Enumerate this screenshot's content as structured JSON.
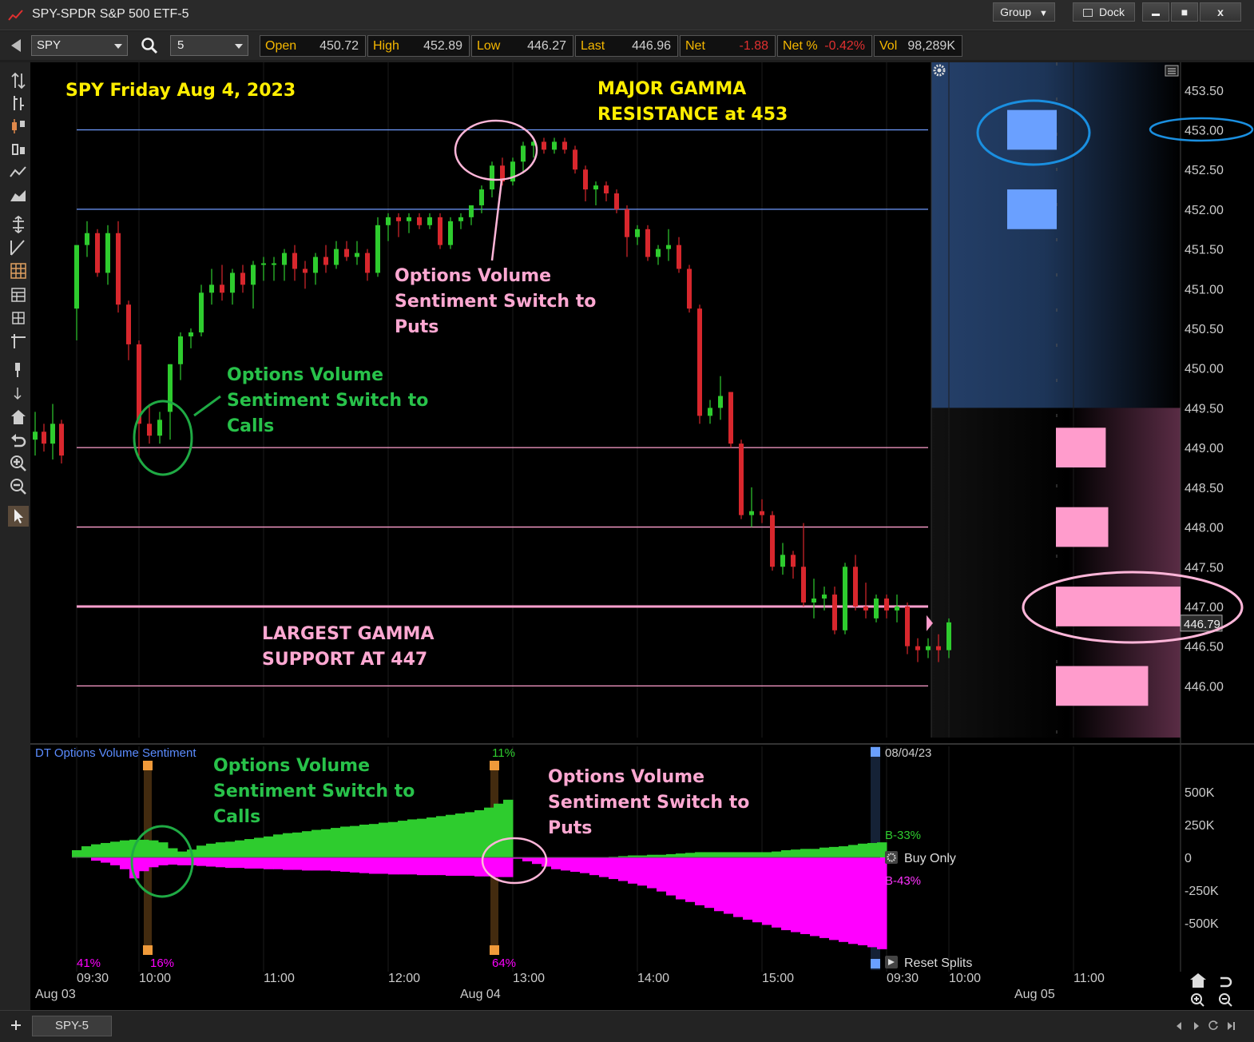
{
  "window": {
    "title": "SPY-SPDR S&P 500 ETF-5",
    "group_label": "Group",
    "dock_label": "Dock",
    "min_label": "▬",
    "max_label": "■",
    "close_label": "x"
  },
  "toolbar": {
    "symbol": "SPY",
    "interval": "5",
    "quotes": [
      {
        "label": "Open",
        "value": "450.72",
        "neg": false
      },
      {
        "label": "High",
        "value": "452.89",
        "neg": false
      },
      {
        "label": "Low",
        "value": "446.27",
        "neg": false
      },
      {
        "label": "Last",
        "value": "446.96",
        "neg": false
      },
      {
        "label": "Net",
        "value": "-1.88",
        "neg": true
      },
      {
        "label": "Net %",
        "value": "-0.42%",
        "neg": true
      },
      {
        "label": "Vol",
        "value": "98,289K",
        "neg": false
      }
    ]
  },
  "tab_label": "SPY-5",
  "colors": {
    "up": "#2ecc2e",
    "down": "#d8272d",
    "resistance_line": "#6f9bff",
    "support_line": "#ff9fce",
    "call_fill": "#2ecc2e",
    "put_fill": "#ff00ff",
    "annot_yellow": "#ffee00",
    "annot_green": "#28c24a",
    "annot_pink": "#ffa8d2"
  },
  "annotations": {
    "chart_title": "SPY Friday Aug 4, 2023",
    "major_gamma_line1": "MAJOR GAMMA",
    "major_gamma_line2": "RESISTANCE at 453",
    "largest_gamma_line1": "LARGEST GAMMA",
    "largest_gamma_line2": "SUPPORT AT 447",
    "calls_switch": [
      "Options Volume",
      "Sentiment Switch to",
      "Calls"
    ],
    "puts_switch": [
      "Options Volume",
      "Sentiment Switch to",
      "Puts"
    ],
    "calls_switch_lower": [
      "Options Volume",
      "Sentiment Switch to",
      "Calls"
    ],
    "puts_switch_lower": [
      "Options Volume",
      "Sentiment Switch to",
      "Puts"
    ]
  },
  "chart_data": [
    {
      "type": "candlestick",
      "title": "SPY Friday Aug 4, 2023",
      "ylim": [
        445.35,
        453.85
      ],
      "y_ticks": [
        "453.50",
        "453.00",
        "452.50",
        "452.00",
        "451.50",
        "451.00",
        "450.50",
        "450.00",
        "449.50",
        "449.00",
        "448.50",
        "448.00",
        "447.50",
        "447.00",
        "446.50",
        "446.00"
      ],
      "last_price_label": "446.79",
      "x_tick_labels": [
        "09:30",
        "10:00",
        "11:00",
        "12:00",
        "13:00",
        "14:00",
        "15:00",
        "09:30",
        "10:00",
        "11:00"
      ],
      "date_labels": [
        "Aug 03",
        "Aug 04",
        "Aug 05"
      ],
      "gamma_levels": [
        {
          "price": 453.0,
          "kind": "resistance",
          "size": 0.2
        },
        {
          "price": 452.0,
          "kind": "resistance",
          "size": 0.2
        },
        {
          "price": 449.0,
          "kind": "support",
          "size": 0.2
        },
        {
          "price": 448.0,
          "kind": "support",
          "size": 0.21
        },
        {
          "price": 447.0,
          "kind": "support",
          "size": 0.5
        },
        {
          "price": 446.0,
          "kind": "support",
          "size": 0.37
        }
      ],
      "candles_prev_day": [
        {
          "o": 449.1,
          "h": 449.45,
          "l": 448.9,
          "c": 449.2
        },
        {
          "o": 449.2,
          "h": 449.3,
          "l": 448.95,
          "c": 449.05
        },
        {
          "o": 449.05,
          "h": 449.55,
          "l": 448.85,
          "c": 449.3
        },
        {
          "o": 449.3,
          "h": 449.35,
          "l": 448.8,
          "c": 448.9
        }
      ],
      "candles": [
        {
          "o": 450.75,
          "h": 451.5,
          "l": 450.35,
          "c": 451.55
        },
        {
          "o": 451.55,
          "h": 451.85,
          "l": 451.4,
          "c": 451.7
        },
        {
          "o": 451.7,
          "h": 451.75,
          "l": 451.15,
          "c": 451.2
        },
        {
          "o": 451.2,
          "h": 451.8,
          "l": 451.05,
          "c": 451.7
        },
        {
          "o": 451.7,
          "h": 451.85,
          "l": 450.7,
          "c": 450.8
        },
        {
          "o": 450.8,
          "h": 450.85,
          "l": 450.1,
          "c": 450.3
        },
        {
          "o": 450.3,
          "h": 450.35,
          "l": 448.85,
          "c": 449.3
        },
        {
          "o": 449.3,
          "h": 449.55,
          "l": 449.05,
          "c": 449.15
        },
        {
          "o": 449.15,
          "h": 449.45,
          "l": 449.05,
          "c": 449.35
        },
        {
          "o": 449.45,
          "h": 450.05,
          "l": 449.1,
          "c": 450.05
        },
        {
          "o": 450.05,
          "h": 450.45,
          "l": 449.85,
          "c": 450.4
        },
        {
          "o": 450.4,
          "h": 450.5,
          "l": 450.25,
          "c": 450.45
        },
        {
          "o": 450.45,
          "h": 451.05,
          "l": 450.4,
          "c": 450.95
        },
        {
          "o": 450.95,
          "h": 451.25,
          "l": 450.8,
          "c": 451.05
        },
        {
          "o": 451.05,
          "h": 451.3,
          "l": 450.85,
          "c": 450.95
        },
        {
          "o": 450.95,
          "h": 451.25,
          "l": 450.8,
          "c": 451.2
        },
        {
          "o": 451.2,
          "h": 451.3,
          "l": 450.95,
          "c": 451.05
        },
        {
          "o": 451.05,
          "h": 451.35,
          "l": 450.75,
          "c": 451.3
        },
        {
          "o": 451.3,
          "h": 451.4,
          "l": 451.1,
          "c": 451.32
        },
        {
          "o": 451.3,
          "h": 451.4,
          "l": 451.1,
          "c": 451.32
        },
        {
          "o": 451.3,
          "h": 451.5,
          "l": 451.1,
          "c": 451.45
        },
        {
          "o": 451.45,
          "h": 451.55,
          "l": 451.1,
          "c": 451.25
        },
        {
          "o": 451.25,
          "h": 451.35,
          "l": 451.0,
          "c": 451.2
        },
        {
          "o": 451.2,
          "h": 451.45,
          "l": 451.05,
          "c": 451.4
        },
        {
          "o": 451.4,
          "h": 451.55,
          "l": 451.2,
          "c": 451.3
        },
        {
          "o": 451.3,
          "h": 451.6,
          "l": 451.25,
          "c": 451.5
        },
        {
          "o": 451.5,
          "h": 451.6,
          "l": 451.35,
          "c": 451.4
        },
        {
          "o": 451.4,
          "h": 451.6,
          "l": 451.3,
          "c": 451.45
        },
        {
          "o": 451.45,
          "h": 451.5,
          "l": 451.1,
          "c": 451.2
        },
        {
          "o": 451.2,
          "h": 451.9,
          "l": 451.15,
          "c": 451.8
        },
        {
          "o": 451.8,
          "h": 451.95,
          "l": 451.6,
          "c": 451.9
        },
        {
          "o": 451.9,
          "h": 451.95,
          "l": 451.65,
          "c": 451.85
        },
        {
          "o": 451.85,
          "h": 451.95,
          "l": 451.7,
          "c": 451.9
        },
        {
          "o": 451.9,
          "h": 451.95,
          "l": 451.75,
          "c": 451.8
        },
        {
          "o": 451.8,
          "h": 451.95,
          "l": 451.75,
          "c": 451.9
        },
        {
          "o": 451.9,
          "h": 451.95,
          "l": 451.5,
          "c": 451.55
        },
        {
          "o": 451.55,
          "h": 451.9,
          "l": 451.5,
          "c": 451.85
        },
        {
          "o": 451.85,
          "h": 451.95,
          "l": 451.75,
          "c": 451.9
        },
        {
          "o": 451.9,
          "h": 452.05,
          "l": 451.8,
          "c": 452.05
        },
        {
          "o": 452.05,
          "h": 452.3,
          "l": 451.95,
          "c": 452.25
        },
        {
          "o": 452.25,
          "h": 452.6,
          "l": 452.15,
          "c": 452.55
        },
        {
          "o": 452.55,
          "h": 452.65,
          "l": 452.3,
          "c": 452.35
        },
        {
          "o": 452.35,
          "h": 452.65,
          "l": 452.3,
          "c": 452.6
        },
        {
          "o": 452.6,
          "h": 452.85,
          "l": 452.45,
          "c": 452.8
        },
        {
          "o": 452.8,
          "h": 452.9,
          "l": 452.65,
          "c": 452.85
        },
        {
          "o": 452.85,
          "h": 452.9,
          "l": 452.7,
          "c": 452.75
        },
        {
          "o": 452.75,
          "h": 452.9,
          "l": 452.7,
          "c": 452.85
        },
        {
          "o": 452.85,
          "h": 452.9,
          "l": 452.7,
          "c": 452.75
        },
        {
          "o": 452.75,
          "h": 452.8,
          "l": 452.45,
          "c": 452.5
        },
        {
          "o": 452.5,
          "h": 452.55,
          "l": 452.1,
          "c": 452.25
        },
        {
          "o": 452.25,
          "h": 452.35,
          "l": 452.05,
          "c": 452.3
        },
        {
          "o": 452.3,
          "h": 452.35,
          "l": 452.1,
          "c": 452.2
        },
        {
          "o": 452.2,
          "h": 452.25,
          "l": 451.95,
          "c": 452.0
        },
        {
          "o": 452.0,
          "h": 452.05,
          "l": 451.4,
          "c": 451.65
        },
        {
          "o": 451.65,
          "h": 451.8,
          "l": 451.55,
          "c": 451.75
        },
        {
          "o": 451.75,
          "h": 451.8,
          "l": 451.35,
          "c": 451.4
        },
        {
          "o": 451.4,
          "h": 451.55,
          "l": 451.3,
          "c": 451.5
        },
        {
          "o": 451.5,
          "h": 451.75,
          "l": 451.35,
          "c": 451.55
        },
        {
          "o": 451.55,
          "h": 451.65,
          "l": 451.2,
          "c": 451.25
        },
        {
          "o": 451.25,
          "h": 451.3,
          "l": 450.7,
          "c": 450.75
        },
        {
          "o": 450.75,
          "h": 450.8,
          "l": 449.3,
          "c": 449.4
        },
        {
          "o": 449.4,
          "h": 449.6,
          "l": 449.3,
          "c": 449.5
        },
        {
          "o": 449.5,
          "h": 449.9,
          "l": 449.35,
          "c": 449.65
        },
        {
          "o": 449.7,
          "h": 449.7,
          "l": 449.0,
          "c": 449.05
        },
        {
          "o": 449.05,
          "h": 449.1,
          "l": 448.1,
          "c": 448.15
        },
        {
          "o": 448.15,
          "h": 448.5,
          "l": 448.0,
          "c": 448.2
        },
        {
          "o": 448.2,
          "h": 448.35,
          "l": 448.05,
          "c": 448.15
        },
        {
          "o": 448.15,
          "h": 448.2,
          "l": 447.45,
          "c": 447.5
        },
        {
          "o": 447.5,
          "h": 447.8,
          "l": 447.4,
          "c": 447.65
        },
        {
          "o": 447.65,
          "h": 447.7,
          "l": 447.35,
          "c": 447.5
        },
        {
          "o": 447.5,
          "h": 448.05,
          "l": 447.0,
          "c": 447.05
        },
        {
          "o": 447.05,
          "h": 447.35,
          "l": 446.85,
          "c": 447.1
        },
        {
          "o": 447.1,
          "h": 447.25,
          "l": 446.95,
          "c": 447.15
        },
        {
          "o": 447.15,
          "h": 447.25,
          "l": 446.65,
          "c": 446.7
        },
        {
          "o": 446.7,
          "h": 447.55,
          "l": 446.65,
          "c": 447.5
        },
        {
          "o": 447.5,
          "h": 447.65,
          "l": 446.95,
          "c": 447.0
        },
        {
          "o": 447.0,
          "h": 447.3,
          "l": 446.85,
          "c": 446.95
        },
        {
          "o": 446.85,
          "h": 447.15,
          "l": 446.8,
          "c": 447.1
        },
        {
          "o": 447.1,
          "h": 447.15,
          "l": 446.85,
          "c": 446.95
        },
        {
          "o": 446.95,
          "h": 447.15,
          "l": 446.8,
          "c": 447.0
        },
        {
          "o": 447.0,
          "h": 447.05,
          "l": 446.4,
          "c": 446.5
        },
        {
          "o": 446.5,
          "h": 446.6,
          "l": 446.3,
          "c": 446.45
        },
        {
          "o": 446.45,
          "h": 446.6,
          "l": 446.35,
          "c": 446.5
        },
        {
          "o": 446.5,
          "h": 446.65,
          "l": 446.3,
          "c": 446.45
        },
        {
          "o": 446.45,
          "h": 446.85,
          "l": 446.35,
          "c": 446.8
        }
      ]
    },
    {
      "type": "area",
      "title": "DT Options Volume Sentiment",
      "ylim": [
        -700,
        700
      ],
      "unit": "K",
      "y_ticks": [
        "500K",
        "250K",
        "0",
        "-250K",
        "-500K"
      ],
      "date_label": "08/04/23",
      "buy_label": "B-33%",
      "sell_label": "B-43%",
      "gear_label": "Buy Only",
      "reset_label": "Reset Splits",
      "percent_labels": [
        {
          "text": "41%",
          "color": "#ff00ff"
        },
        {
          "text": "16%",
          "color": "#ff00ff"
        },
        {
          "text": "11%",
          "color": "#2ecc2e"
        },
        {
          "text": "64%",
          "color": "#ff00ff"
        }
      ],
      "calls": [
        55,
        85,
        100,
        110,
        120,
        130,
        135,
        135,
        130,
        115,
        70,
        45,
        60,
        90,
        105,
        115,
        120,
        130,
        140,
        150,
        160,
        175,
        185,
        190,
        200,
        210,
        215,
        225,
        235,
        240,
        250,
        255,
        265,
        270,
        280,
        290,
        295,
        305,
        315,
        325,
        335,
        345,
        360,
        380,
        410,
        440,
        0,
        0,
        0,
        0,
        0,
        0,
        0,
        0,
        0,
        0,
        5,
        10,
        15,
        15,
        20,
        20,
        25,
        30,
        35,
        40,
        40,
        40,
        40,
        40,
        40,
        40,
        40,
        45,
        55,
        60,
        65,
        65,
        75,
        80,
        85,
        95,
        105,
        110,
        115
      ],
      "puts": [
        0,
        0,
        -25,
        -40,
        -60,
        -90,
        -160,
        -105,
        -75,
        -60,
        -55,
        -60,
        -60,
        -65,
        -70,
        -75,
        -80,
        -80,
        -85,
        -85,
        -90,
        -90,
        -95,
        -95,
        -100,
        -100,
        -100,
        -105,
        -110,
        -115,
        -120,
        -125,
        -125,
        -130,
        -130,
        -130,
        -135,
        -135,
        -135,
        -140,
        -140,
        -140,
        -145,
        -145,
        -150,
        -150,
        -10,
        -30,
        -50,
        -70,
        -90,
        -100,
        -110,
        -120,
        -135,
        -150,
        -165,
        -180,
        -200,
        -215,
        -235,
        -260,
        -290,
        -320,
        -340,
        -365,
        -385,
        -410,
        -430,
        -455,
        -475,
        -495,
        -515,
        -535,
        -555,
        -570,
        -585,
        -600,
        -615,
        -630,
        -645,
        -660,
        -670,
        -685,
        -700
      ]
    }
  ]
}
